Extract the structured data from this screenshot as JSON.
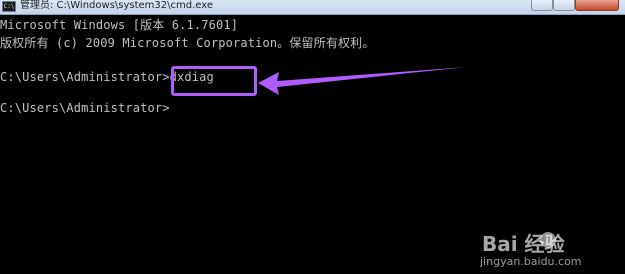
{
  "window": {
    "title": "管理员: C:\\Windows\\system32\\cmd.exe",
    "icon_text": "C:\\"
  },
  "console": {
    "lines": [
      "Microsoft Windows [版本 6.1.7601]",
      "版权所有 (c) 2009 Microsoft Corporation。保留所有权利。",
      "C:\\Users\\Administrator>dxdiag",
      "C:\\Users\\Administrator>"
    ]
  },
  "annotation": {
    "color": "#b05cff"
  },
  "watermark": {
    "logo": "Bai  经验",
    "url": "jingyan.baidu.com"
  }
}
